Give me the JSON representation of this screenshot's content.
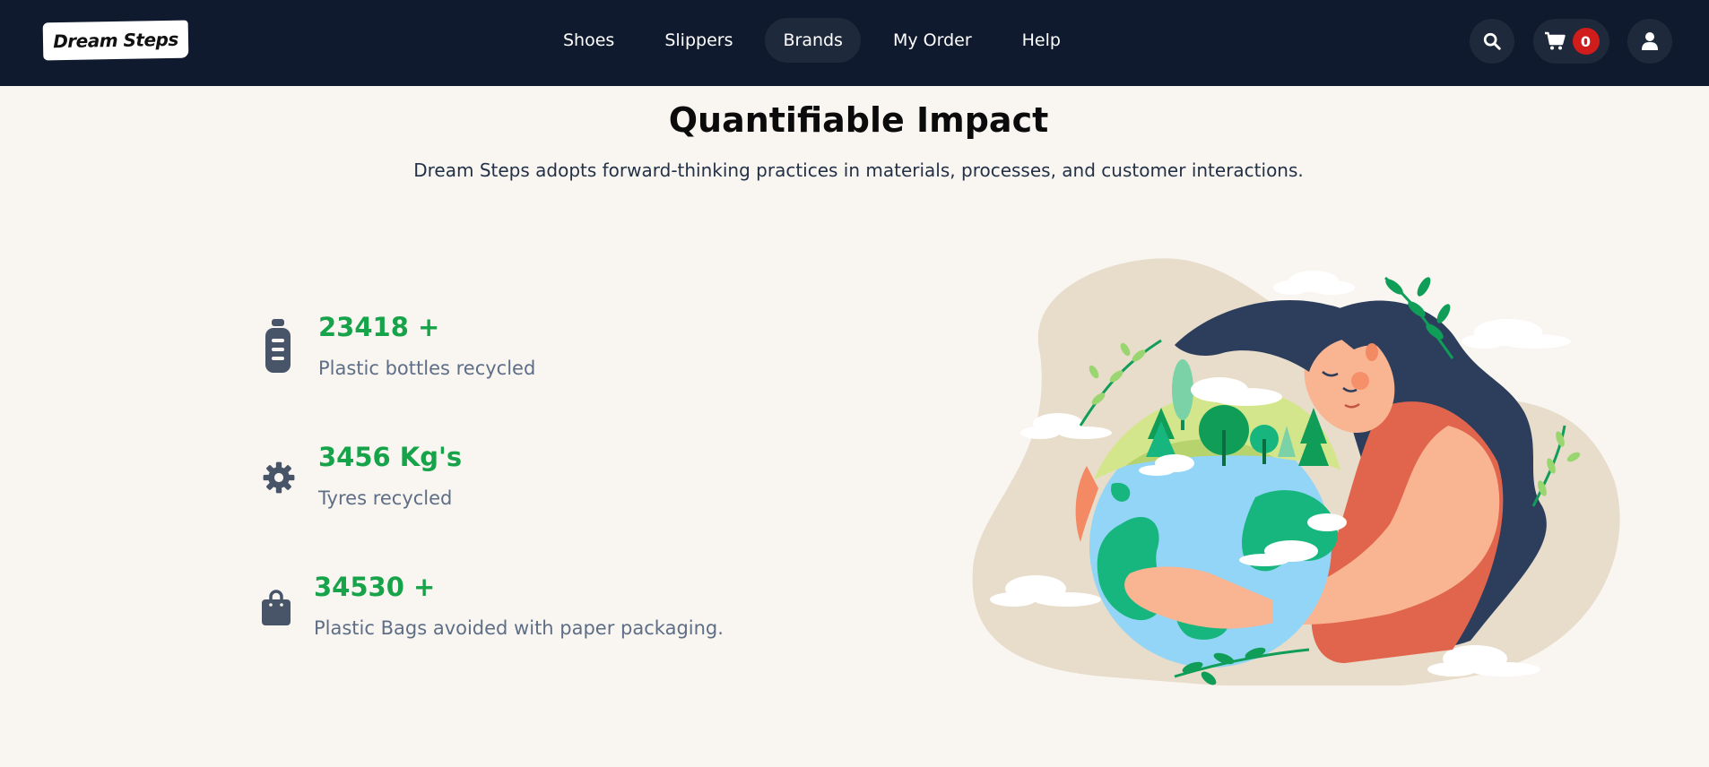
{
  "brand": {
    "name": "Dream Steps"
  },
  "nav": {
    "items": [
      {
        "label": "Shoes"
      },
      {
        "label": "Slippers"
      },
      {
        "label": "Brands"
      },
      {
        "label": "My Order"
      },
      {
        "label": "Help"
      }
    ],
    "active": "Brands",
    "cart_count": "0"
  },
  "icons": [
    "search-icon",
    "cart-icon",
    "user-icon",
    "bottle-icon",
    "gear-icon",
    "bag-icon"
  ],
  "colors": {
    "navbar": "#101a2e",
    "accent": "#17a34a",
    "badge": "#d11c1c",
    "background": "#f9f6f2"
  },
  "impact": {
    "title": "Quantifiable Impact",
    "subtitle": "Dream Steps adopts forward-thinking practices in materials, processes, and customer interactions.",
    "stats": [
      {
        "value": "23418 +",
        "label": "Plastic bottles recycled",
        "icon": "bottle-icon"
      },
      {
        "value": "3456 Kg's",
        "label": "Tyres recycled",
        "icon": "gear-icon"
      },
      {
        "value": "34530 +",
        "label": "Plastic Bags avoided with paper packaging.",
        "icon": "bag-icon"
      }
    ]
  }
}
